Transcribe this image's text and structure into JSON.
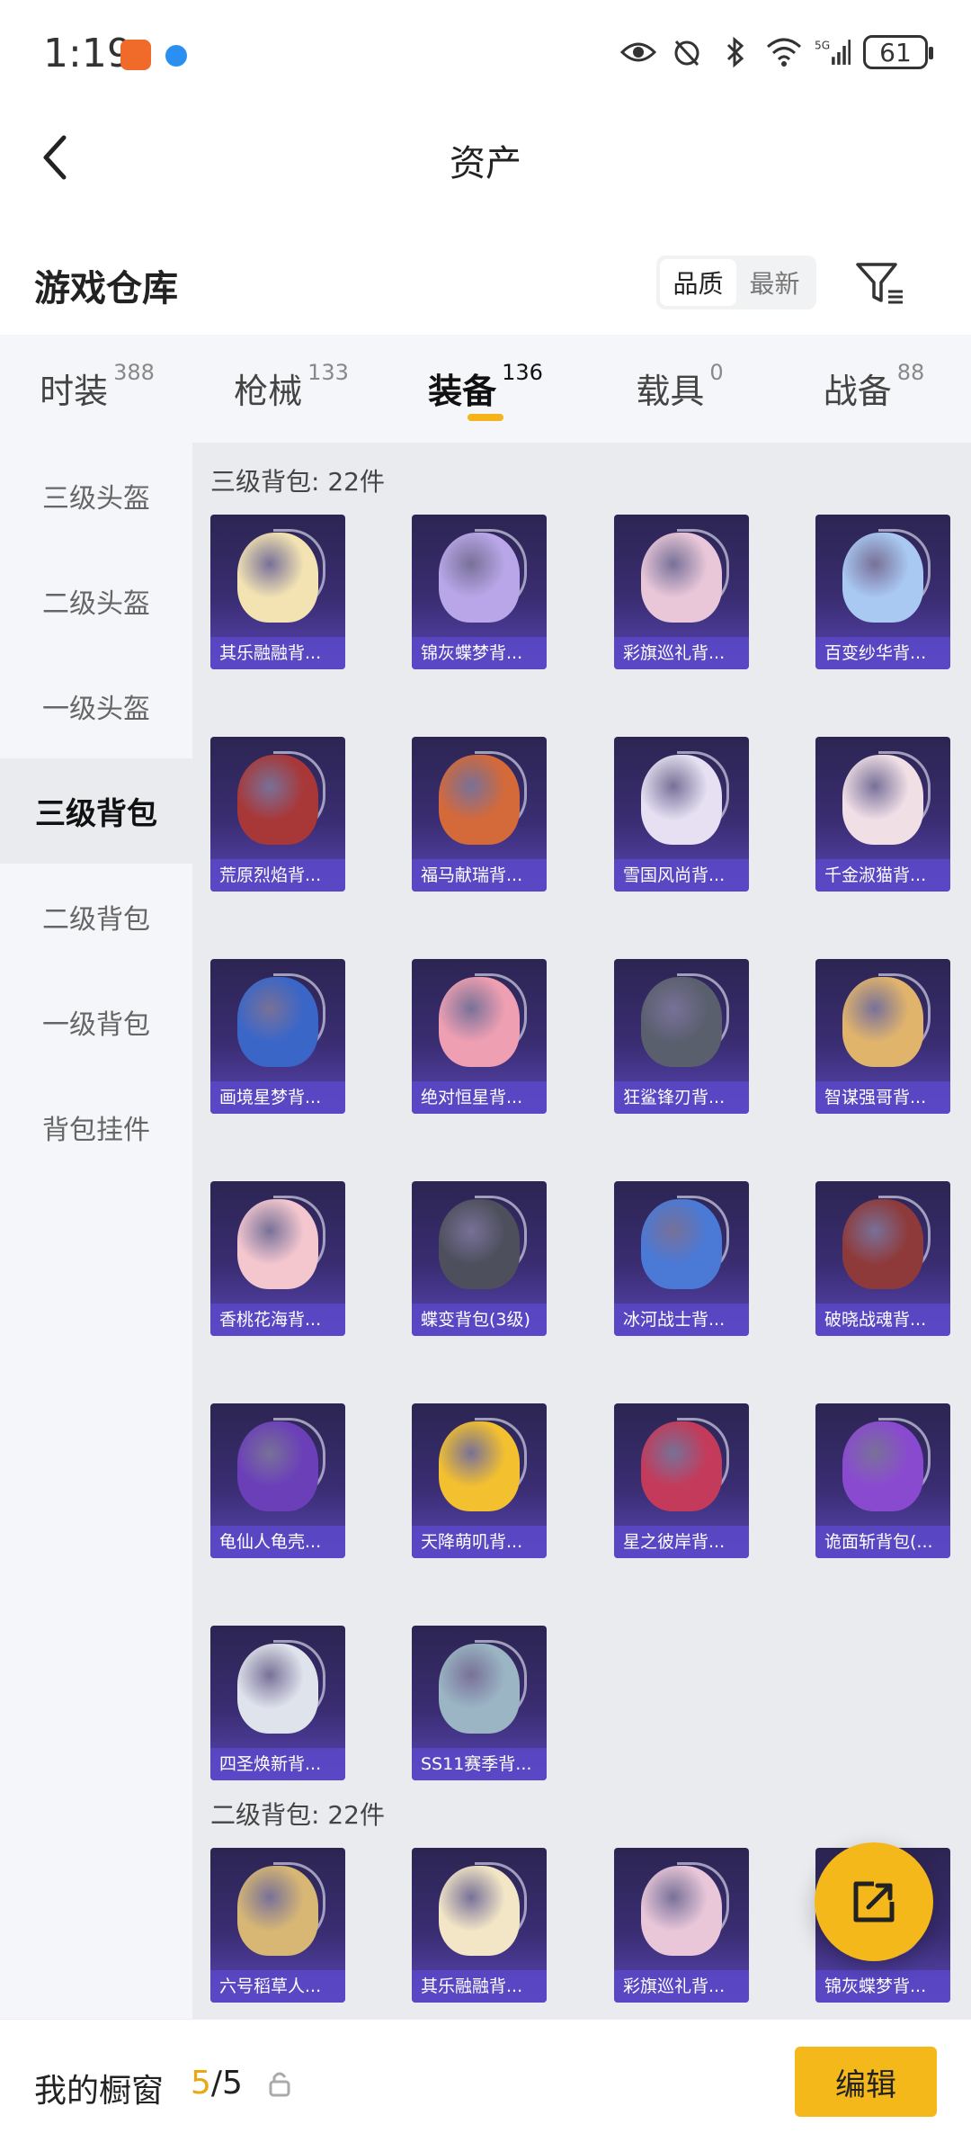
{
  "status_bar": {
    "time": "1:19",
    "battery": "61",
    "network": "5G"
  },
  "header": {
    "title": "资产"
  },
  "warehouse": {
    "title": "游戏仓库",
    "sort_options": [
      "品质",
      "最新"
    ],
    "active_sort": "品质"
  },
  "tabs": [
    {
      "label": "时装",
      "count": "388"
    },
    {
      "label": "枪械",
      "count": "133"
    },
    {
      "label": "装备",
      "count": "136",
      "active": true
    },
    {
      "label": "载具",
      "count": "0"
    },
    {
      "label": "战备",
      "count": "88"
    }
  ],
  "side_nav": [
    "三级头盔",
    "二级头盔",
    "一级头盔",
    "三级背包",
    "二级背包",
    "一级背包",
    "背包挂件"
  ],
  "active_side_item": "三级背包",
  "sections": [
    {
      "heading": "三级背包: 22件",
      "items": [
        {
          "name": "其乐融融背...",
          "color": "#f3e3b2"
        },
        {
          "name": "锦灰蝶梦背...",
          "color": "#b9a6e8"
        },
        {
          "name": "彩旗巡礼背...",
          "color": "#e9c7d9"
        },
        {
          "name": "百变纱华背...",
          "color": "#a9c8f2"
        },
        {
          "name": "荒原烈焰背...",
          "color": "#a83838"
        },
        {
          "name": "福马献瑞背...",
          "color": "#d4693a"
        },
        {
          "name": "雪国风尚背...",
          "color": "#e6e0f2"
        },
        {
          "name": "千金淑猫背...",
          "color": "#f1dfe6"
        },
        {
          "name": "画境星梦背...",
          "color": "#3a66c8"
        },
        {
          "name": "绝对恒星背...",
          "color": "#ef9fb2"
        },
        {
          "name": "狂鲨锋刃背...",
          "color": "#5a5f6e"
        },
        {
          "name": "智谋强哥背...",
          "color": "#e1b46c"
        },
        {
          "name": "香桃花海背...",
          "color": "#f4c7cf"
        },
        {
          "name": "蝶变背包(3级)",
          "color": "#4d4f5c"
        },
        {
          "name": "冰河战士背...",
          "color": "#4a79d6"
        },
        {
          "name": "破晓战魂背...",
          "color": "#8f3a3a"
        },
        {
          "name": "龟仙人龟壳...",
          "color": "#6b3fb8"
        },
        {
          "name": "天降萌叽背...",
          "color": "#f3c02f"
        },
        {
          "name": "星之彼岸背...",
          "color": "#c43a5a"
        },
        {
          "name": "诡面斩背包(...",
          "color": "#8a4ad0"
        },
        {
          "name": "四圣焕新背...",
          "color": "#dfe3ec"
        },
        {
          "name": "SS11赛季背...",
          "color": "#9bb5c4"
        }
      ]
    },
    {
      "heading": "二级背包: 22件",
      "items": [
        {
          "name": "六号稻草人...",
          "color": "#d8b774"
        },
        {
          "name": "其乐融融背...",
          "color": "#f3e6c6"
        },
        {
          "name": "彩旗巡礼背...",
          "color": "#e9c7d9"
        },
        {
          "name": "锦灰蝶梦背...",
          "color": "#b9a6e8"
        }
      ]
    }
  ],
  "bottom_bar": {
    "showcase_label": "我的橱窗",
    "showcase_current": "5",
    "showcase_total": "/5",
    "edit_label": "编辑"
  }
}
